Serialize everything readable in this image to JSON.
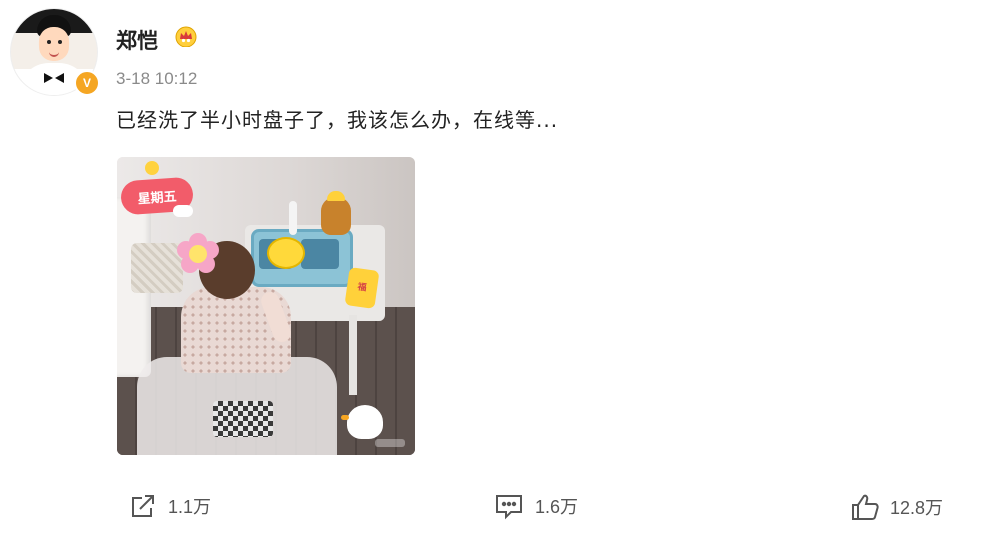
{
  "post": {
    "author": "郑恺",
    "time": "3-18 10:12",
    "text": "已经洗了半小时盘子了，我该怎么办，在线等...",
    "verified_badge": "V",
    "image_sticker_text": "星期五",
    "image_sticker2_text": "福"
  },
  "actions": {
    "share_count": "1.1万",
    "comment_count": "1.6万",
    "like_count": "12.8万"
  },
  "icons": {
    "share": "share-icon",
    "comment": "comment-icon",
    "like": "thumbs-up-icon",
    "member_crown": "crown-icon"
  },
  "colors": {
    "verified": "#f5a623",
    "text": "#222222",
    "meta": "#8a8a8a"
  }
}
